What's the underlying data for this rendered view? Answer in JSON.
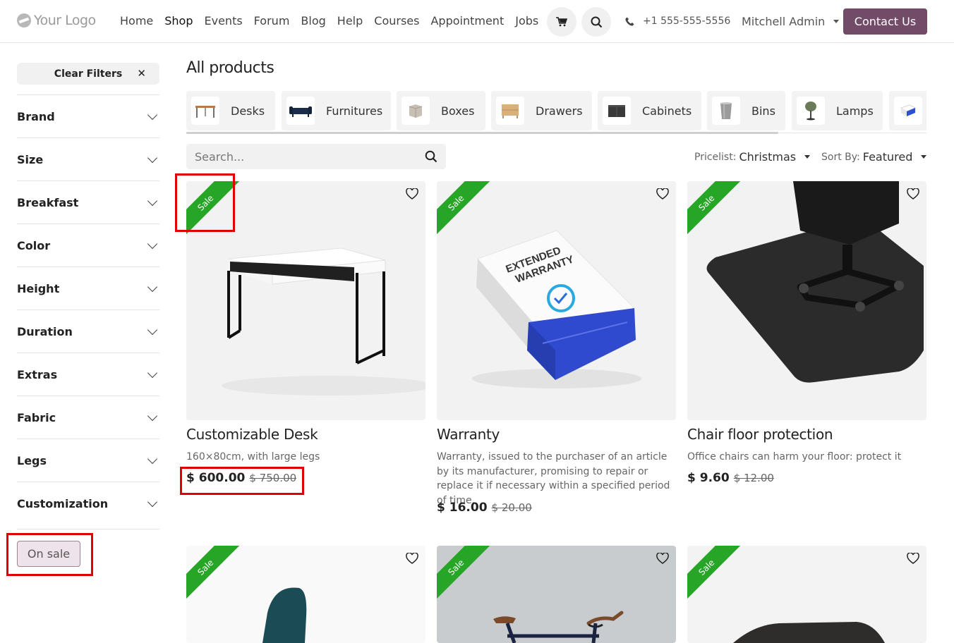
{
  "header": {
    "logo_text": "Your Logo",
    "nav": [
      "Home",
      "Shop",
      "Events",
      "Forum",
      "Blog",
      "Help",
      "Courses",
      "Appointment",
      "Jobs"
    ],
    "active_nav": "Shop",
    "cart_icon": "cart-icon",
    "search_icon": "search-icon",
    "phone": "+1 555-555-5556",
    "user": "Mitchell Admin",
    "contact_button": "Contact Us"
  },
  "sidebar": {
    "clear_filters": "Clear Filters",
    "filters": [
      "Brand",
      "Size",
      "Breakfast",
      "Color",
      "Height",
      "Duration",
      "Extras",
      "Fabric",
      "Legs",
      "Customization"
    ],
    "on_sale": "On sale"
  },
  "main": {
    "title": "All products",
    "categories": [
      "Desks",
      "Furnitures",
      "Boxes",
      "Drawers",
      "Cabinets",
      "Bins",
      "Lamps"
    ],
    "search_placeholder": "Search...",
    "pricelist_label": "Pricelist:",
    "pricelist_value": "Christmas",
    "sort_label": "Sort By:",
    "sort_value": "Featured",
    "ribbon": "Sale",
    "products": [
      {
        "name": "Customizable Desk",
        "desc": "160×80cm, with large legs",
        "price": "$ 600.00",
        "old_price": "$ 750.00"
      },
      {
        "name": "Warranty",
        "desc": "Warranty, issued to the purchaser of an article by its manufacturer, promising to repair or replace it if necessary within a specified period of time.",
        "price": "$ 16.00",
        "old_price": "$ 20.00"
      },
      {
        "name": "Chair floor protection",
        "desc": "Office chairs can harm your floor: protect it",
        "price": "$ 9.60",
        "old_price": "$ 12.00"
      }
    ],
    "warranty_box_text": "EXTENDED WARRANTY"
  },
  "colors": {
    "brand": "#714b67",
    "ribbon": "#26a526",
    "highlight": "#e00000"
  }
}
